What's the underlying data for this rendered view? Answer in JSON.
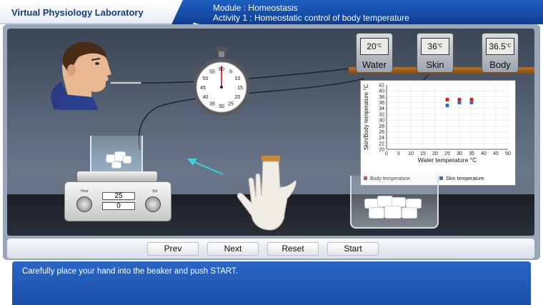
{
  "header": {
    "app_title": "Virtual Physiology Laboratory",
    "module_line": "Module : Homeostasis",
    "activity_line": "Activity 1 : Homeostatic control of body temperature"
  },
  "displays": [
    {
      "value": "20",
      "unit": "°C",
      "label": "Water"
    },
    {
      "value": "36",
      "unit": "°C",
      "label": "Skin"
    },
    {
      "value": "36.5",
      "unit": "°C",
      "label": "Body"
    }
  ],
  "stopwatch": {
    "dial_numbers": [
      "60",
      "5",
      "10",
      "15",
      "20",
      "25",
      "30",
      "35",
      "40",
      "45",
      "50",
      "55"
    ]
  },
  "hotplate": {
    "readout_top": "25",
    "readout_bottom": "0",
    "left_knob_label": "Heat",
    "right_knob_label": "Stir"
  },
  "chart_data": {
    "type": "scatter",
    "xlabel": "Water temperature °C",
    "ylabel": "Skin/Body temperature °C",
    "xlim": [
      0,
      50
    ],
    "ylim": [
      20,
      42
    ],
    "x_ticks": [
      "0",
      "5",
      "10",
      "15",
      "20",
      "25",
      "30",
      "35",
      "40",
      "45",
      "50"
    ],
    "y_ticks": [
      "20",
      "22",
      "24",
      "26",
      "28",
      "30",
      "32",
      "34",
      "36",
      "38",
      "40",
      "42"
    ],
    "grid": true,
    "legend_position": "bottom",
    "series": [
      {
        "name": "Body  temperature",
        "color": "#e02020",
        "points": [
          [
            25,
            37
          ],
          [
            30,
            37
          ],
          [
            35,
            37
          ]
        ]
      },
      {
        "name": "Skin  temperature",
        "color": "#2a6fd6",
        "points": [
          [
            25,
            35
          ],
          [
            30,
            36
          ],
          [
            35,
            36
          ]
        ]
      }
    ]
  },
  "nav": {
    "prev": "Prev",
    "next": "Next",
    "reset": "Reset",
    "start": "Start"
  },
  "instruction": "Carefully place your hand into the beaker and push START.",
  "colors": {
    "header_blue": "#0d3f92",
    "title_blue": "#143a8a",
    "instruction_blue": "#1a4ea8",
    "arrow_cyan": "#3fd0e0"
  }
}
